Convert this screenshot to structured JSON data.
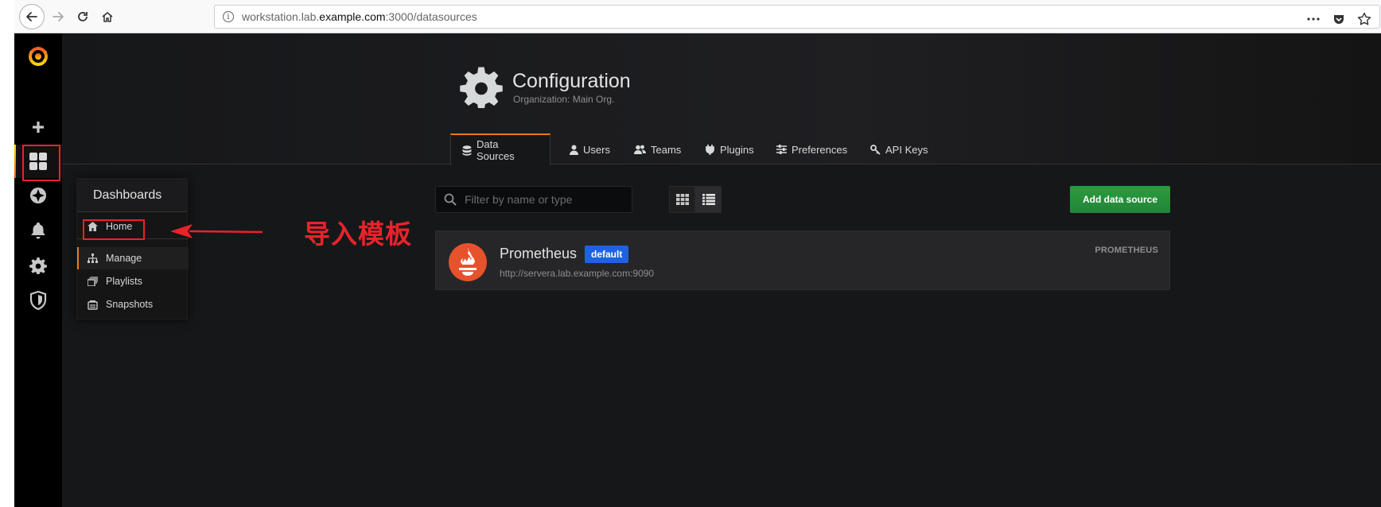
{
  "browser": {
    "url_prefix": "workstation.lab.",
    "url_host": "example.com",
    "url_suffix": ":3000/datasources",
    "icons": [
      "back-icon",
      "forward-icon",
      "reload-icon",
      "home-icon",
      "info-icon",
      "more-icon",
      "pocket-icon",
      "bookmark-star-icon"
    ]
  },
  "sidemenu": {
    "items": [
      "grafana-logo",
      "plus-icon",
      "dashboards-icon",
      "explore-icon",
      "bell-icon",
      "gear-icon",
      "shield-icon"
    ]
  },
  "header": {
    "title": "Configuration",
    "subtitle": "Organization: Main Org."
  },
  "tabs": [
    {
      "label": "Data Sources",
      "icon": "database-icon",
      "active": true
    },
    {
      "label": "Users",
      "icon": "user-icon"
    },
    {
      "label": "Teams",
      "icon": "users-icon"
    },
    {
      "label": "Plugins",
      "icon": "plug-icon"
    },
    {
      "label": "Preferences",
      "icon": "sliders-icon"
    },
    {
      "label": "API Keys",
      "icon": "key-icon"
    }
  ],
  "toolbar": {
    "search_placeholder": "Filter by name or type",
    "add_button": "Add data source"
  },
  "datasource": {
    "name": "Prometheus",
    "badge": "default",
    "url": "http://servera.lab.example.com:9090",
    "type": "PROMETHEUS"
  },
  "flyout": {
    "title": "Dashboards",
    "items": [
      "Home",
      "Manage",
      "Playlists",
      "Snapshots"
    ]
  },
  "annotation": {
    "text": "导入模板",
    "color": "#e8232a"
  },
  "colors": {
    "accent": "#eb7b18",
    "add_button": "#299c46",
    "badge": "#1f62e0"
  }
}
